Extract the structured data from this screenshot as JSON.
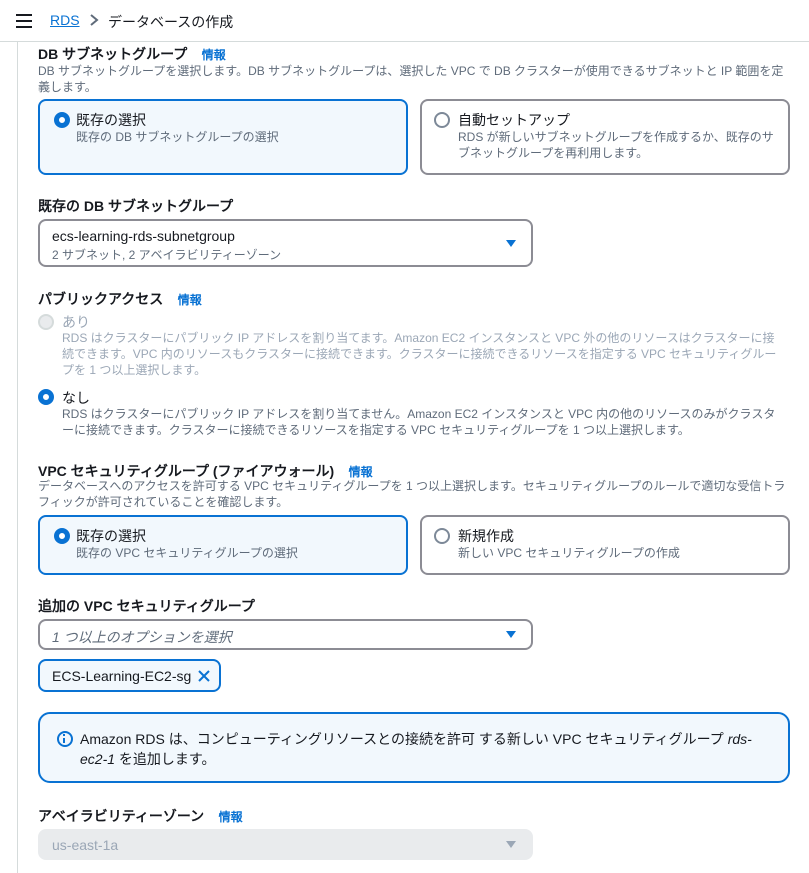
{
  "breadcrumb": {
    "root": "RDS",
    "current": "データベースの作成"
  },
  "db_subnet_group": {
    "title": "DB サブネットグループ",
    "info": "情報",
    "description": "DB サブネットグループを選択します。DB サブネットグループは、選択した VPC で DB クラスターが使用できるサブネットと IP 範囲を定義します。",
    "options": [
      {
        "title": "既存の選択",
        "desc": "既存の DB サブネットグループの選択",
        "selected": true
      },
      {
        "title": "自動セットアップ",
        "desc": "RDS が新しいサブネットグループを作成するか、既存のサブネットグループを再利用します。",
        "selected": false
      }
    ]
  },
  "existing_subnet_group": {
    "label": "既存の DB サブネットグループ",
    "value": "ecs-learning-rds-subnetgroup",
    "sub": "2 サブネット, 2 アベイラビリティーゾーン"
  },
  "public_access": {
    "title": "パブリックアクセス",
    "info": "情報",
    "options": [
      {
        "title": "あり",
        "desc": "RDS はクラスターにパブリック IP アドレスを割り当てます。Amazon EC2 インスタンスと VPC 外の他のリソースはクラスターに接続できます。VPC 内のリソースもクラスターに接続できます。クラスターに接続できるリソースを指定する VPC セキュリティグループを 1 つ以上選択します。",
        "selected": false,
        "disabled": true
      },
      {
        "title": "なし",
        "desc": "RDS はクラスターにパブリック IP アドレスを割り当てません。Amazon EC2 インスタンスと VPC 内の他のリソースのみがクラスターに接続できます。クラスターに接続できるリソースを指定する VPC セキュリティグループを 1 つ以上選択します。",
        "selected": true,
        "disabled": false
      }
    ]
  },
  "vpc_sg": {
    "title": "VPC セキュリティグループ (ファイアウォール)",
    "info": "情報",
    "description": "データベースへのアクセスを許可する VPC セキュリティグループを 1 つ以上選択します。セキュリティグループのルールで適切な受信トラフィックが許可されていることを確認します。",
    "options": [
      {
        "title": "既存の選択",
        "desc": "既存の VPC セキュリティグループの選択",
        "selected": true
      },
      {
        "title": "新規作成",
        "desc": "新しい VPC セキュリティグループの作成",
        "selected": false
      }
    ]
  },
  "additional_sg": {
    "label": "追加の VPC セキュリティグループ",
    "placeholder": "1 つ以上のオプションを選択",
    "tokens": [
      "ECS-Learning-EC2-sg"
    ]
  },
  "alert": {
    "text_main": "Amazon RDS は、コンピューティングリソースとの接続を許可 する新しい VPC セキュリティグループ ",
    "text_em1": "rds-",
    "text_em2": "ec2-1",
    "text_tail": " を追加します。"
  },
  "availability_zone": {
    "title": "アベイラビリティーゾーン",
    "info": "情報",
    "value": "us-east-1a"
  },
  "colors": {
    "accent": "#0972d3",
    "selected_bg": "#f2f8fd",
    "border": "#8c8c94",
    "muted": "#5f6b7a"
  },
  "icons": {
    "menu": "hamburger-icon",
    "chevron": "chevron-right-icon",
    "caret": "caret-down-icon",
    "remove": "close-icon",
    "info": "info-circle-icon"
  }
}
